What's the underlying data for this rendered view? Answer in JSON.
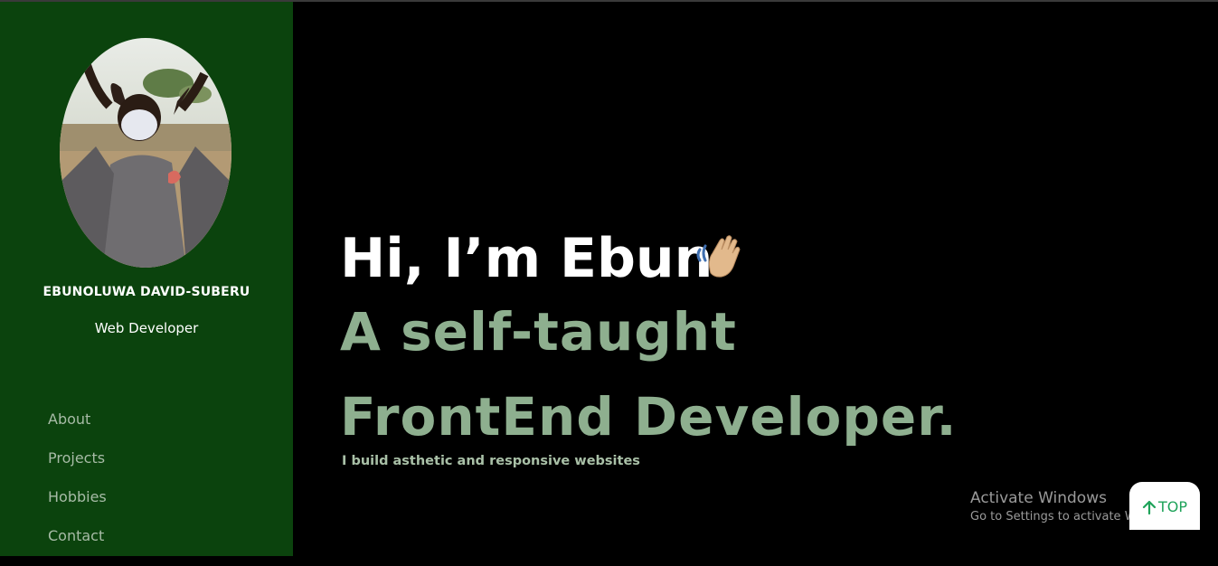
{
  "profile": {
    "name": "EBUNOLUWA DAVID-SUBERU",
    "role": "Web Developer"
  },
  "nav": {
    "items": [
      {
        "label": "About"
      },
      {
        "label": "Projects"
      },
      {
        "label": "Hobbies"
      },
      {
        "label": "Contact"
      }
    ]
  },
  "hero": {
    "greeting": "Hi, I’m Ebun",
    "headline": "A self-taught FrontEnd Developer.",
    "tagline": "I build asthetic and responsive websites",
    "wave_icon": "waving-hand-emoji"
  },
  "scroll_top": {
    "label": "TOP",
    "icon": "arrow-up-icon"
  },
  "watermark": {
    "line1": "Activate Windows",
    "line2": "Go to Settings to activate Windows."
  },
  "colors": {
    "sidebar_bg": "#0b430d",
    "main_bg": "#000000",
    "headline": "#8eaf8f",
    "nav_text": "#a7bba6",
    "top_button_text": "#1fa35a"
  }
}
